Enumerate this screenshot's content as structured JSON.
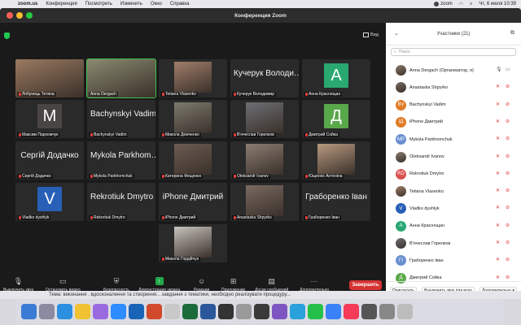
{
  "menubar": {
    "app": "zoom.us",
    "items": [
      "Конференция",
      "Посмотреть",
      "Изменить",
      "Окно",
      "Справка"
    ],
    "datetime": "Чт, 6 июля  10:39",
    "zoom_label": "zoom"
  },
  "window": {
    "title": "Конференция Zoom",
    "view_label": "Вид"
  },
  "tiles": [
    {
      "name": "Лобунець Тетяна",
      "kind": "photo",
      "color": "#9a7a60",
      "active": false
    },
    {
      "name": "Anna Dergach",
      "kind": "photo",
      "color": "#8a8a70",
      "active": true
    },
    {
      "name": "Tetiana Vlasenko",
      "kind": "photo",
      "color": "#a07e6a",
      "active": false
    },
    {
      "name": "Кучерук Володимир",
      "kind": "text",
      "big": "Кучерук Володи…",
      "active": false
    },
    {
      "name": "Анна Краснощан",
      "kind": "avatar",
      "letter": "А",
      "color": "#2aa872",
      "active": false
    },
    {
      "name": "Максим Пархомчук",
      "kind": "avatar",
      "letter": "М",
      "color": "#4a4545",
      "active": false
    },
    {
      "name": "Bachynskyi Vadim",
      "kind": "text",
      "big": "Bachynskyi Vadim",
      "active": false
    },
    {
      "name": "Микола Демченко",
      "kind": "photo",
      "color": "#7d7a6f",
      "active": false
    },
    {
      "name": "В'ячеслав Горелков",
      "kind": "photo",
      "color": "#6d6f74",
      "active": false
    },
    {
      "name": "Дмитрий Сойка",
      "kind": "avatar",
      "letter": "Д",
      "color": "#59a84a",
      "active": false
    },
    {
      "name": "Сергій Додачко",
      "kind": "text",
      "big": "Сергій Додачко",
      "active": false
    },
    {
      "name": "Mykola Parkhomchuk",
      "kind": "text",
      "big": "Mykola Parkhom…",
      "active": false
    },
    {
      "name": "Катерина Фещенко",
      "kind": "photo",
      "color": "#6c5c52",
      "active": false
    },
    {
      "name": "Oleksandr Ivanov",
      "kind": "photo",
      "color": "#8b7d72",
      "active": false
    },
    {
      "name": "Ющенко Антоніна",
      "kind": "photo",
      "color": "#b89a80",
      "active": false
    },
    {
      "name": "Vladko dyshlyk",
      "kind": "avatar",
      "letter": "V",
      "color": "#2860b8",
      "active": false
    },
    {
      "name": "Rekrotiuk Dmytro",
      "kind": "text",
      "big": "Rekrotiuk Dmytro",
      "active": false
    },
    {
      "name": "iPhone Дмитрий",
      "kind": "text",
      "big": "iPhone Дмитрий",
      "active": false
    },
    {
      "name": "Anastasiia Shpyrko",
      "kind": "photo",
      "color": "#7a6a62",
      "active": false
    },
    {
      "name": "Граборенко Іван",
      "kind": "text",
      "big": "Граборенко Іван",
      "active": false
    },
    {
      "name": "Микола Гордійчук",
      "kind": "photo",
      "color": "#c9c4be",
      "active": false
    }
  ],
  "toolbar": {
    "mute": "Выключить звук",
    "video": "Остановить видео",
    "security": "Безопасность",
    "share": "Демонстрация экрана",
    "reactions": "Реакции",
    "apps": "Приложение",
    "whiteboards": "Доски сообщений",
    "more": "Дополнительно",
    "end": "Завершить"
  },
  "panel": {
    "title": "Участники (21)",
    "search_placeholder": "Поиск",
    "participants": [
      {
        "name": "Anna Dergach (Организатор, я)",
        "avatar_type": "photo",
        "color": "#8a7a6a",
        "initials": "",
        "mic_on": true,
        "cam_on": true
      },
      {
        "name": "Anastasiia Shpyrko",
        "avatar_type": "photo",
        "color": "#7a6a62",
        "initials": "",
        "mic_on": false,
        "cam_on": false
      },
      {
        "name": "Bachynskyi Vadim",
        "avatar_type": "initials",
        "color": "#e07b26",
        "initials": "BV",
        "mic_on": false,
        "cam_on": false
      },
      {
        "name": "iPhone Дмитрий",
        "avatar_type": "initials",
        "color": "#e07b26",
        "initials": "IД",
        "mic_on": false,
        "cam_on": false
      },
      {
        "name": "Mykola Parkhomchuk",
        "avatar_type": "initials",
        "color": "#6a8fd0",
        "initials": "MP",
        "mic_on": false,
        "cam_on": false
      },
      {
        "name": "Oleksandr Ivanov",
        "avatar_type": "photo",
        "color": "#8b7d72",
        "initials": "",
        "mic_on": false,
        "cam_on": false
      },
      {
        "name": "Rekrotiuk Dmytro",
        "avatar_type": "initials",
        "color": "#d9534f",
        "initials": "RD",
        "mic_on": false,
        "cam_on": false
      },
      {
        "name": "Tetiana Vlasenko",
        "avatar_type": "photo",
        "color": "#a07e6a",
        "initials": "",
        "mic_on": false,
        "cam_on": false
      },
      {
        "name": "Vladko dyshlyk",
        "avatar_type": "initials",
        "color": "#2860b8",
        "initials": "V",
        "mic_on": false,
        "cam_on": false
      },
      {
        "name": "Анна Краснощан",
        "avatar_type": "initials",
        "color": "#2aa872",
        "initials": "А",
        "mic_on": false,
        "cam_on": false
      },
      {
        "name": "В'ячеслав Горелков",
        "avatar_type": "photo",
        "color": "#6d6f74",
        "initials": "",
        "mic_on": false,
        "cam_on": false
      },
      {
        "name": "Граборенко Іван",
        "avatar_type": "initials",
        "color": "#6a8fd0",
        "initials": "ГІ",
        "mic_on": false,
        "cam_on": false
      },
      {
        "name": "Дмитрий Сойка",
        "avatar_type": "initials",
        "color": "#59a84a",
        "initials": "Д",
        "mic_on": false,
        "cam_on": false
      }
    ],
    "invite": "Пригласить",
    "mute_all": "Выключить звук для всех",
    "more": "Дополнительно ▾"
  },
  "doc_strip": "Тема: виконання . вдосконалення та створення... завдання з тематики, необхідно реалізувати процедуру..."
}
